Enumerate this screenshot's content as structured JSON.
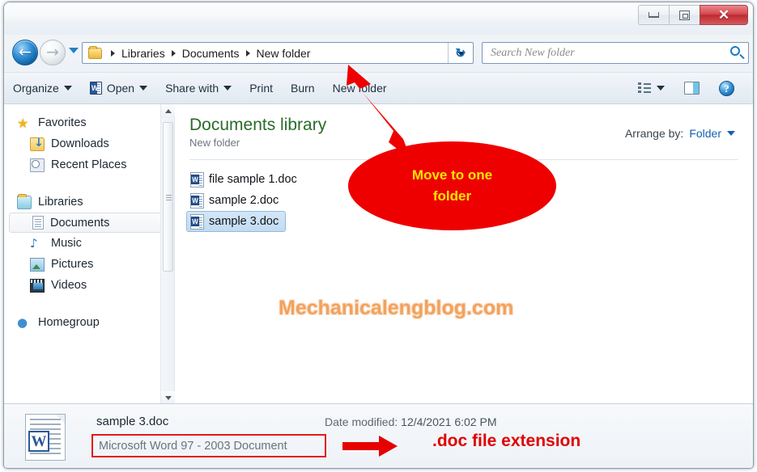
{
  "window": {
    "controls": {
      "minimize": "–",
      "maximize": "□",
      "close": "✕"
    }
  },
  "addressbar": {
    "back_glyph": "←",
    "forward_glyph": "→",
    "crumbs": [
      "Libraries",
      "Documents",
      "New folder"
    ],
    "refresh_glyph": "↻"
  },
  "search": {
    "placeholder": "Search New folder",
    "value": ""
  },
  "toolbar": {
    "organize": "Organize",
    "open": "Open",
    "share_with": "Share with",
    "print": "Print",
    "burn": "Burn",
    "new_folder": "New folder",
    "help_glyph": "?"
  },
  "navpane": {
    "items": [
      {
        "label": "Favorites",
        "icon": "star-icon",
        "level": 0,
        "selected": false
      },
      {
        "label": "Downloads",
        "icon": "downloads-folder-icon",
        "level": 1,
        "selected": false
      },
      {
        "label": "Recent Places",
        "icon": "recent-places-icon",
        "level": 1,
        "selected": false
      },
      {
        "label": "Libraries",
        "icon": "libraries-folder-icon",
        "level": 0,
        "selected": false
      },
      {
        "label": "Documents",
        "icon": "documents-library-icon",
        "level": 1,
        "selected": true
      },
      {
        "label": "Music",
        "icon": "music-note-icon",
        "level": 1,
        "selected": false
      },
      {
        "label": "Pictures",
        "icon": "picture-icon",
        "level": 1,
        "selected": false
      },
      {
        "label": "Videos",
        "icon": "video-film-icon",
        "level": 1,
        "selected": false
      },
      {
        "label": "Homegroup",
        "icon": "homegroup-icon",
        "level": 0,
        "selected": false
      }
    ]
  },
  "content": {
    "library_title": "Documents library",
    "library_subtitle": "New folder",
    "arrange_label": "Arrange by:",
    "arrange_value": "Folder",
    "files": [
      {
        "name": "file sample 1.doc",
        "selected": false
      },
      {
        "name": "sample 2.doc",
        "selected": false
      },
      {
        "name": "sample 3.doc",
        "selected": true
      }
    ],
    "watermark": "Mechanicalengblog.com"
  },
  "details": {
    "file_name": "sample 3.doc",
    "file_type": "Microsoft Word 97 - 2003 Document",
    "date_modified_label": "Date modified:",
    "date_modified_value": "12/4/2021 6:02 PM"
  },
  "annotations": {
    "callout_line1": "Move to one",
    "callout_line2": "folder",
    "ext_label": ".doc file extension"
  },
  "colors": {
    "annotation_red": "#ee0000",
    "annotation_yellow": "#ffe600",
    "ext_red": "#e00000",
    "library_title_green": "#2a6b2a",
    "watermark_orange": "#f1a25e",
    "link_blue": "#1461b0"
  }
}
